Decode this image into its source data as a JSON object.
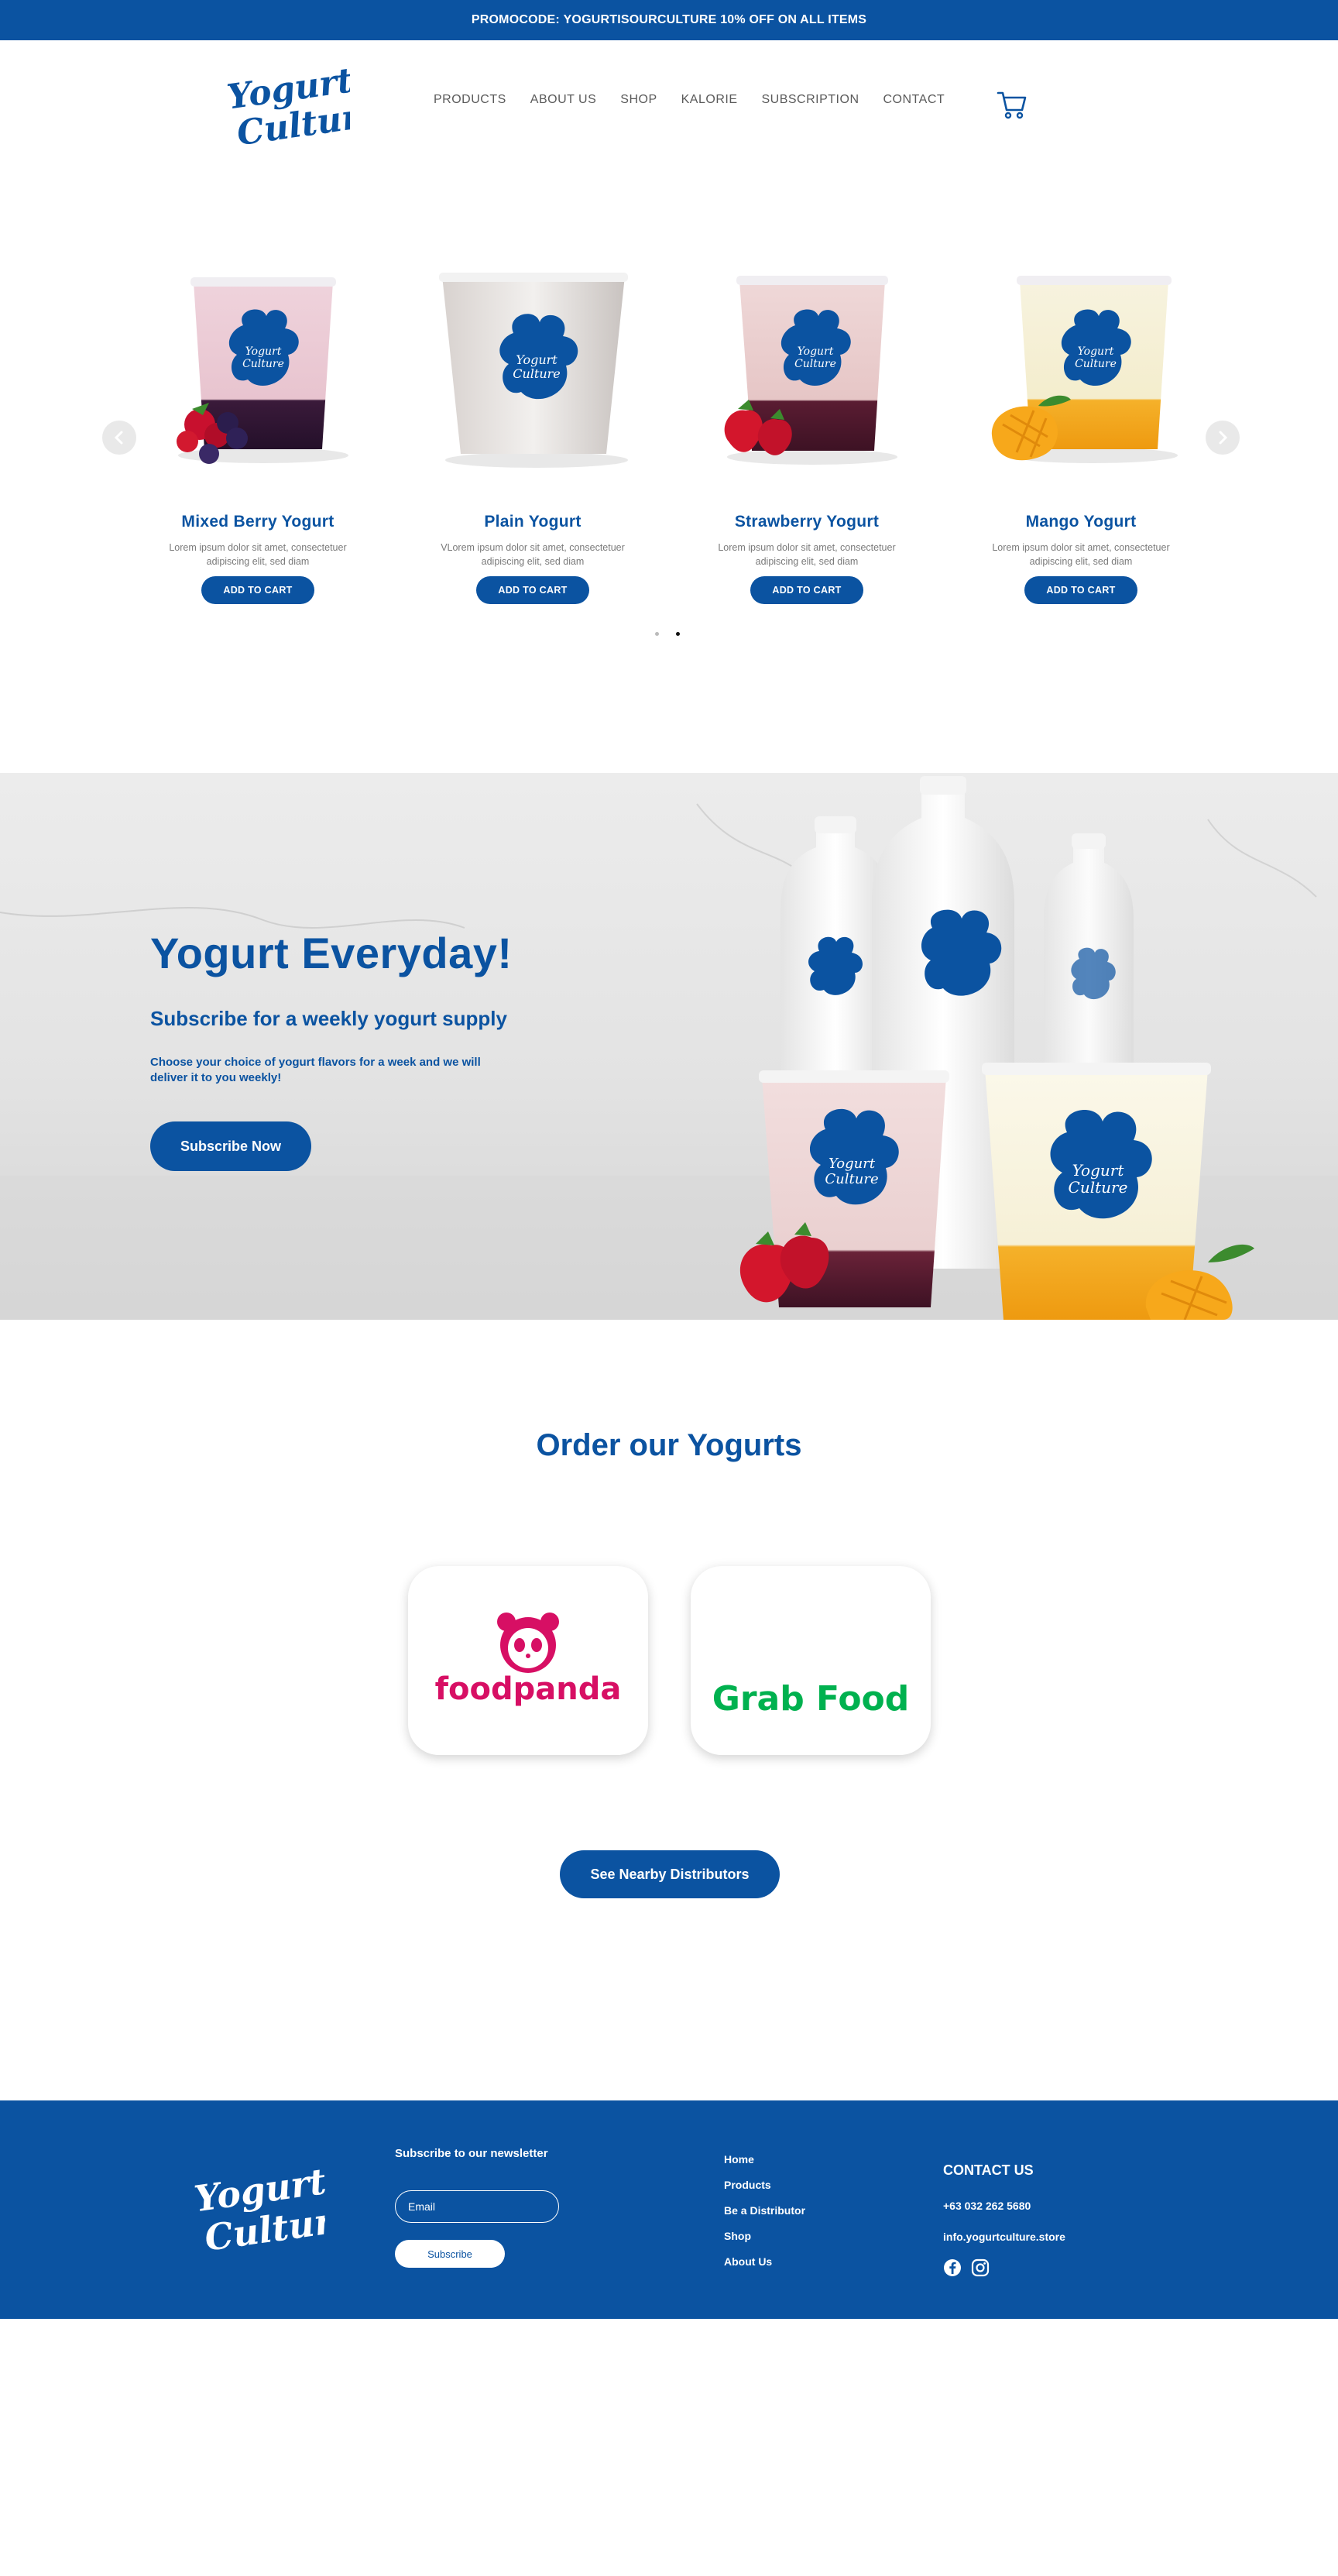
{
  "promo": {
    "prefix": "PROMOCODE:",
    "code": "YOGURTISOURCULTURE",
    "suffix": "10% OFF ON ALL ITEMS"
  },
  "header": {
    "logo_text": "Yogurt Culture",
    "nav": [
      "PRODUCTS",
      "ABOUT US",
      "SHOP",
      "KALORIE",
      "SUBSCRIPTION",
      "CONTACT"
    ],
    "cart_icon": "cart-icon"
  },
  "products": [
    {
      "name": "Mixed Berry Yogurt",
      "desc": "Lorem ipsum dolor sit amet, consectetuer adipiscing elit, sed diam",
      "button": "ADD TO CART"
    },
    {
      "name": "Plain Yogurt",
      "desc": "VLorem ipsum dolor sit amet, consectetuer adipiscing elit, sed diam",
      "button": "ADD TO CART"
    },
    {
      "name": "Strawberry Yogurt",
      "desc": "Lorem ipsum dolor sit amet, consectetuer adipiscing elit, sed diam",
      "button": "ADD TO CART"
    },
    {
      "name": "Mango Yogurt",
      "desc": "Lorem ipsum dolor sit amet, consectetuer adipiscing elit, sed diam",
      "button": "ADD TO CART"
    }
  ],
  "hero": {
    "title": "Yogurt Everyday!",
    "subtitle": "Subscribe for a weekly yogurt supply",
    "text": "Choose your choice of yogurt flavors for a week and we will deliver it to you weekly!",
    "button": "Subscribe Now"
  },
  "order": {
    "title": "Order our Yogurts",
    "partners": [
      "foodpanda",
      "Grab Food"
    ],
    "distributors_button": "See Nearby Distributors"
  },
  "footer": {
    "logo_text": "Yogurt Culture",
    "newsletter_title": "Subscribe to our newsletter",
    "email_placeholder": "Email",
    "subscribe_button": "Subscribe",
    "links": [
      "Home",
      "Products",
      "Be a Distributor",
      "Shop",
      "About Us"
    ],
    "contact_title": "CONTACT US",
    "phone": "+63 032 262 5680",
    "email": "info.yogurtculture.store"
  },
  "colors": {
    "brand_blue": "#0b53a1",
    "foodpanda_pink": "#d70f64",
    "grab_green": "#00b14f"
  }
}
